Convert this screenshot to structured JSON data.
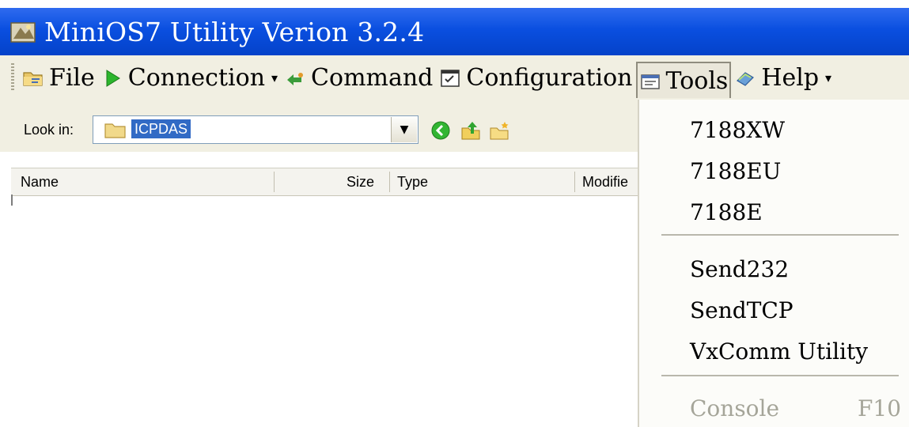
{
  "window": {
    "title": "MiniOS7 Utility Verion 3.2.4",
    "icon": "app-icon"
  },
  "menubar": {
    "items": [
      {
        "label": "File",
        "icon": "folder-icon"
      },
      {
        "label": "Connection",
        "icon": "play-icon",
        "has_dropdown": true
      },
      {
        "label": "Command",
        "icon": "command-icon"
      },
      {
        "label": "Configuration",
        "icon": "configuration-icon"
      },
      {
        "label": "Tools",
        "icon": "tools-icon",
        "active": true
      },
      {
        "label": "Help",
        "icon": "help-icon",
        "has_dropdown": true
      }
    ]
  },
  "browser": {
    "look_in_label": "Look in:",
    "look_in_value": "ICPDAS",
    "columns": [
      "Name",
      "Size",
      "Type",
      "Modifie"
    ]
  },
  "tools_menu": {
    "group1": [
      "7188XW",
      "7188EU",
      "7188E"
    ],
    "group2": [
      "Send232",
      "SendTCP",
      "VxComm Utility"
    ],
    "group3": [
      {
        "label": "Console",
        "shortcut": "F10",
        "disabled": true
      }
    ]
  },
  "colors": {
    "titlebar": "#0a4fe0",
    "menubar": "#f1efe2",
    "selection": "#316ac5"
  }
}
